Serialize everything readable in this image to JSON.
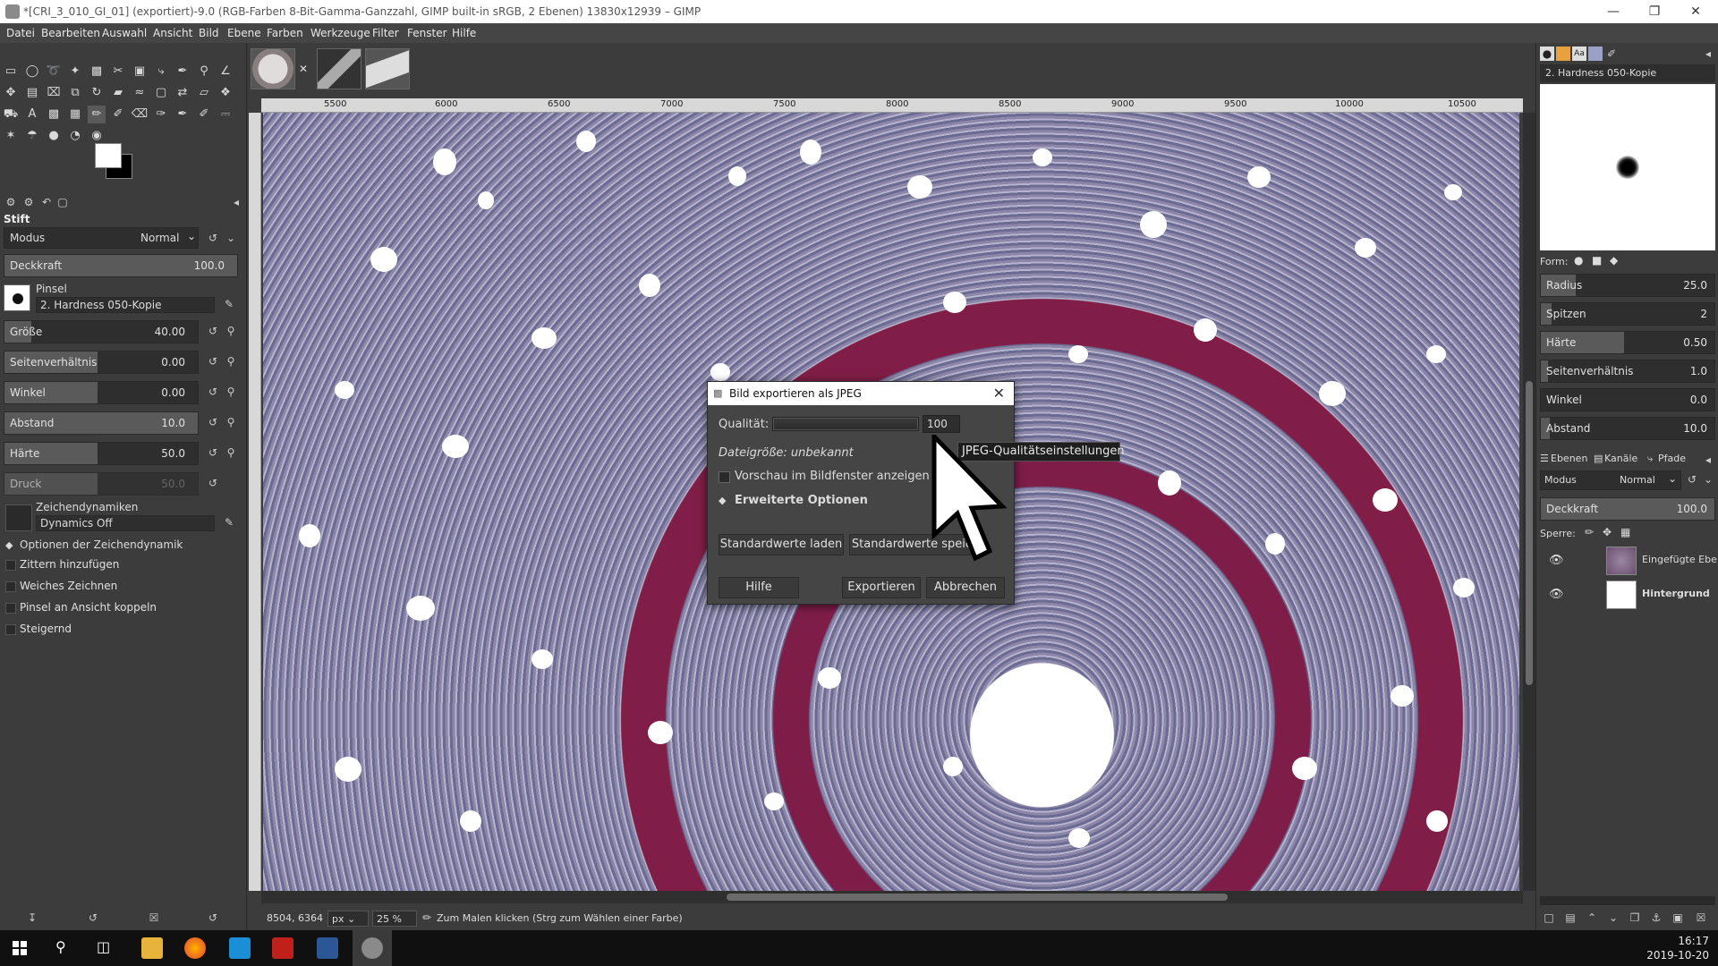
{
  "window": {
    "title": "*[CRI_3_010_GI_01] (exportiert)-9.0 (RGB-Farben 8-Bit-Gamma-Ganzzahl, GIMP built-in sRGB, 2 Ebenen) 13830x12939 – GIMP"
  },
  "menu": [
    "Datei",
    "Bearbeiten",
    "Auswahl",
    "Ansicht",
    "Bild",
    "Ebene",
    "Farben",
    "Werkzeuge",
    "Filter",
    "Fenster",
    "Hilfe"
  ],
  "tool_options": {
    "tool_name": "Stift",
    "mode_label": "Modus",
    "mode_value": "Normal",
    "opacity_label": "Deckkraft",
    "opacity_value": "100.0",
    "brush_label": "Pinsel",
    "brush_value": "2. Hardness 050-Kopie",
    "sliders": [
      {
        "label": "Größe",
        "value": "40.00"
      },
      {
        "label": "Seitenverhältnis",
        "value": "0.00"
      },
      {
        "label": "Winkel",
        "value": "0.00"
      },
      {
        "label": "Abstand",
        "value": "10.0"
      },
      {
        "label": "Härte",
        "value": "50.0"
      },
      {
        "label": "Druck",
        "value": "50.0"
      }
    ],
    "dynamics_label": "Zeichendynamiken",
    "dynamics_value": "Dynamics Off",
    "dynamics_options_label": "Optionen der Zeichendynamik",
    "checkboxes": [
      "Zittern hinzufügen",
      "Weiches Zeichnen",
      "Pinsel an Ansicht koppeln",
      "Steigernd"
    ]
  },
  "ruler": {
    "h_ticks": [
      "5500",
      "6000",
      "6500",
      "7000",
      "7500",
      "8000",
      "8500",
      "9000",
      "9500",
      "10000",
      "10500"
    ]
  },
  "statusbar": {
    "coords": "8504, 6364",
    "unit": "px",
    "zoom": "25 %",
    "message": "Zum Malen klicken (Strg zum Wählen einer Farbe)"
  },
  "brush_editor": {
    "brush_name": "2. Hardness 050-Kopie",
    "shape_label": "Form:",
    "params": [
      {
        "label": "Radius",
        "value": "25.0"
      },
      {
        "label": "Spitzen",
        "value": "2"
      },
      {
        "label": "Härte",
        "value": "0.50"
      },
      {
        "label": "Seitenverhältnis",
        "value": "1.0"
      },
      {
        "label": "Winkel",
        "value": "0.0"
      },
      {
        "label": "Abstand",
        "value": "10.0"
      }
    ]
  },
  "layers_panel": {
    "tabs": [
      "Ebenen",
      "Kanäle",
      "Pfade"
    ],
    "mode_label": "Modus",
    "mode_value": "Normal",
    "opacity_label": "Deckkraft",
    "opacity_value": "100.0",
    "lock_label": "Sperre:",
    "layers": [
      {
        "name": "Eingefügte Ebe"
      },
      {
        "name": "Hintergrund"
      }
    ]
  },
  "dialog": {
    "title": "Bild exportieren als JPEG",
    "quality_label": "Qualität:",
    "quality_value": "100",
    "quality_fraction": 1.0,
    "filesize_text": "Dateigröße: unbekannt",
    "preview_label": "Vorschau im Bildfenster anzeigen",
    "advanced_label": "Erweiterte Optionen",
    "load_defaults": "Standardwerte laden",
    "save_defaults": "Standardwerte speic",
    "help": "Hilfe",
    "export": "Exportieren",
    "cancel": "Abbrechen"
  },
  "tooltip": "JPEG-Qualitätseinstellungen",
  "taskbar": {
    "time": "16:17",
    "date": "2019-10-20"
  }
}
